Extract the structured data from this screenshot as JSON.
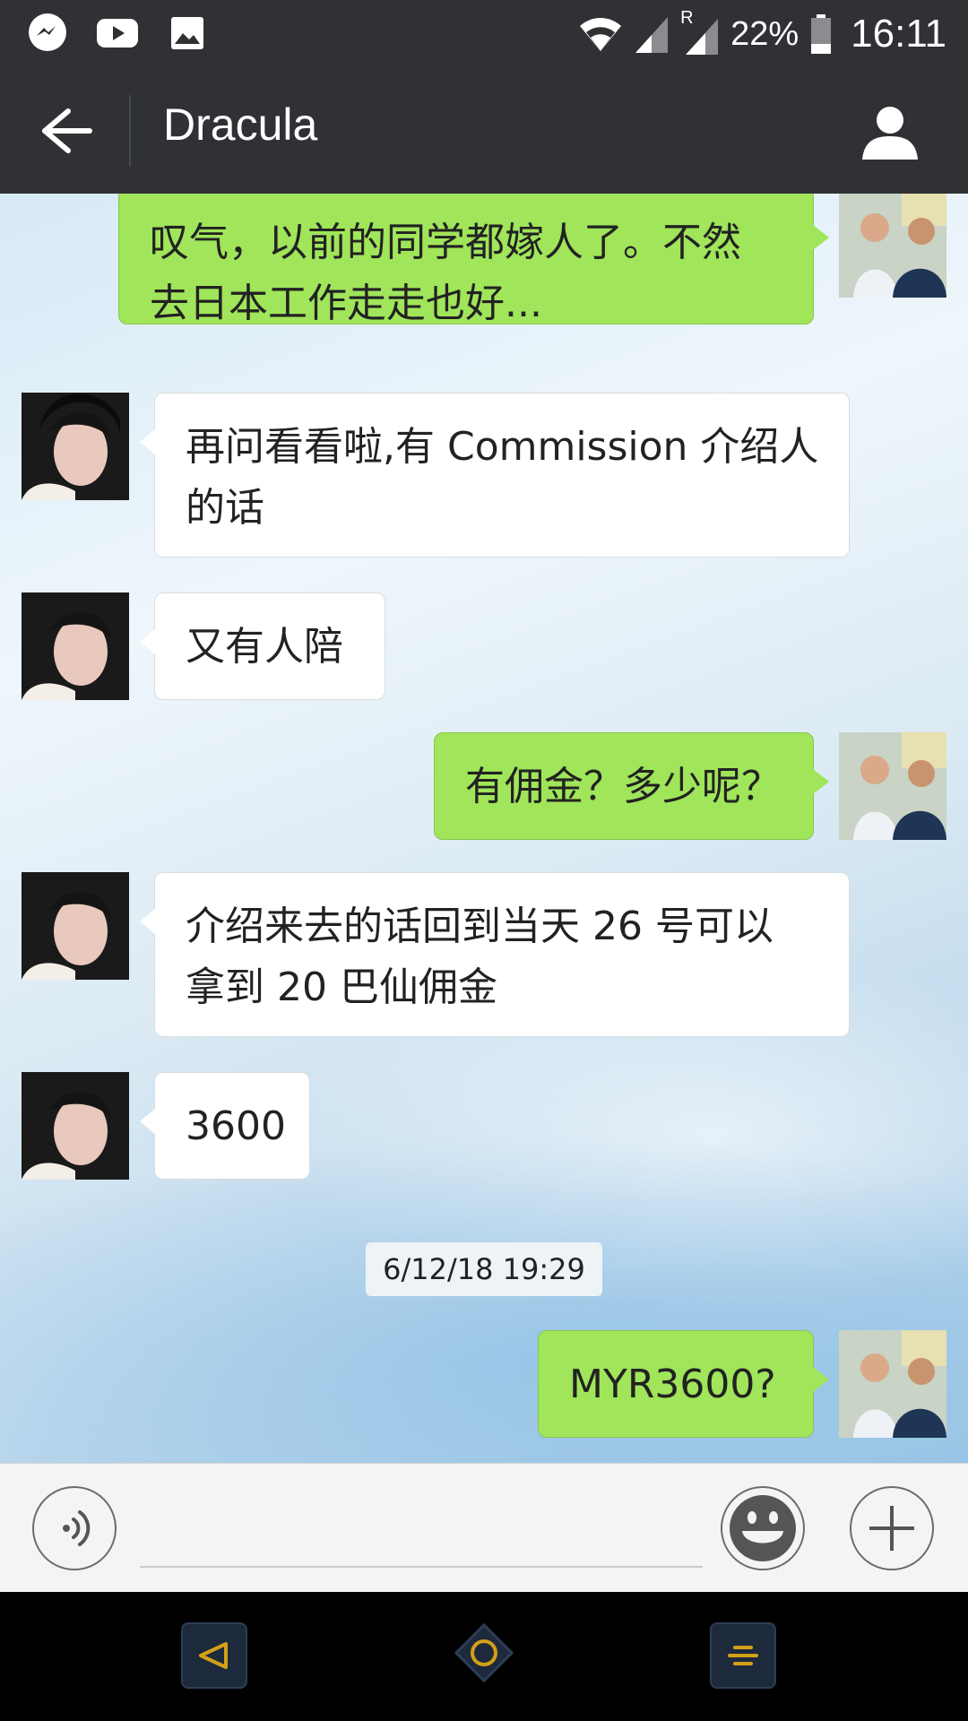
{
  "status_bar": {
    "icons": [
      "messenger-icon",
      "youtube-icon",
      "gallery-icon",
      "wifi-icon",
      "signal-icon",
      "roaming-signal-icon",
      "battery-icon"
    ],
    "roaming_label": "R",
    "battery": "22%",
    "time": "16:11"
  },
  "header": {
    "title": "Dracula",
    "back_icon": "arrow-left-icon",
    "profile_icon": "person-icon"
  },
  "messages": [
    {
      "sender": "me",
      "text_lines": [
        "叹气，以前的同学都嫁人了。不然",
        "去日本工作走走也好..."
      ]
    },
    {
      "sender": "them",
      "text_lines": [
        "再问看看啦,有 Commission 介绍人",
        "的话"
      ]
    },
    {
      "sender": "them",
      "text_lines": [
        "又有人陪"
      ]
    },
    {
      "sender": "me",
      "text_lines": [
        "有佣金？多少呢？"
      ]
    },
    {
      "sender": "them",
      "text_lines": [
        "介绍来去的话回到当天 26 号可以",
        "拿到 20 巴仙佣金"
      ]
    },
    {
      "sender": "them",
      "text_lines": [
        "3600"
      ]
    },
    {
      "sender": "me",
      "text_lines": [
        "MYR3600?"
      ]
    }
  ],
  "timestamp": "6/12/18 19:29",
  "input_bar": {
    "voice_icon": "voice-icon",
    "emoji_icon": "smiley-icon",
    "plus_icon": "plus-icon",
    "text_value": ""
  },
  "nav_bar": {
    "icons": [
      "nav-back-icon",
      "nav-home-icon",
      "nav-menu-icon"
    ]
  },
  "colors": {
    "header_bg": "#2f3135",
    "my_bubble": "#a0e55a",
    "their_bubble": "#ffffff",
    "nav_bg": "#000000"
  }
}
